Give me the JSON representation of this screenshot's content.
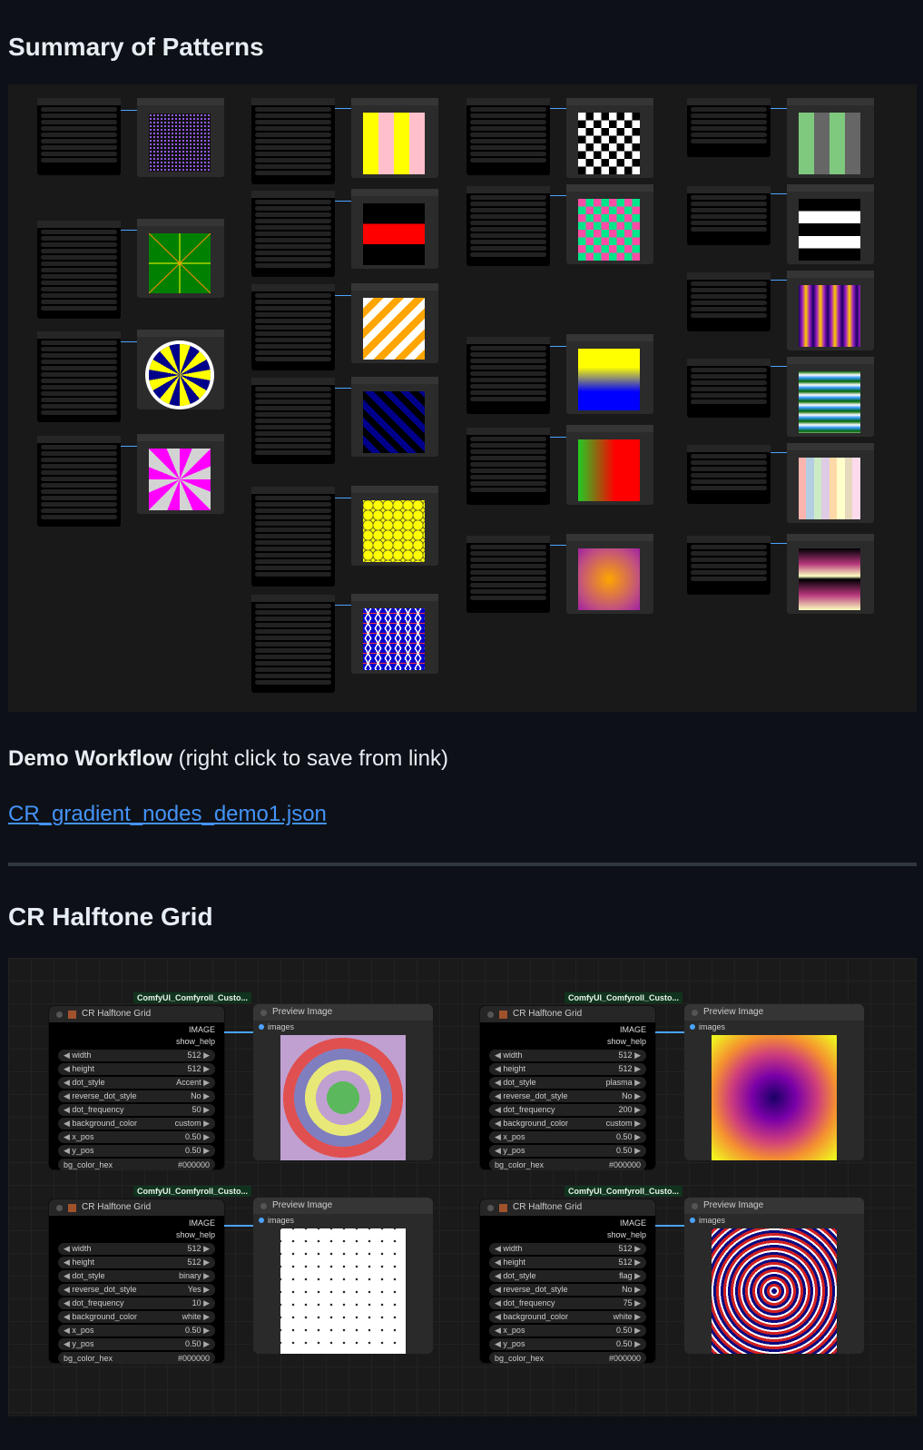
{
  "section1": {
    "title": "Summary of Patterns"
  },
  "demo": {
    "label_bold": "Demo Workflow",
    "label_rest": " (right click to save from link)",
    "link_text": "CR_gradient_nodes_demo1.json"
  },
  "section2": {
    "title": "CR Halftone Grid"
  },
  "halftone_nodes": [
    {
      "badge": "ComfyUI_Comfyroll_Custo...",
      "title": "CR Halftone Grid",
      "output": "IMAGE",
      "show_help": "show_help",
      "widgets": [
        {
          "label": "width",
          "value": "512"
        },
        {
          "label": "height",
          "value": "512"
        },
        {
          "label": "dot_style",
          "value": "Accent"
        },
        {
          "label": "reverse_dot_style",
          "value": "No"
        },
        {
          "label": "dot_frequency",
          "value": "50"
        },
        {
          "label": "background_color",
          "value": "custom"
        },
        {
          "label": "x_pos",
          "value": "0.50"
        },
        {
          "label": "y_pos",
          "value": "0.50"
        },
        {
          "label": "bg_color_hex",
          "value": "#000000"
        }
      ],
      "preview_title": "Preview Image",
      "preview_input": "images"
    },
    {
      "badge": "ComfyUI_Comfyroll_Custo...",
      "title": "CR Halftone Grid",
      "output": "IMAGE",
      "show_help": "show_help",
      "widgets": [
        {
          "label": "width",
          "value": "512"
        },
        {
          "label": "height",
          "value": "512"
        },
        {
          "label": "dot_style",
          "value": "plasma"
        },
        {
          "label": "reverse_dot_style",
          "value": "No"
        },
        {
          "label": "dot_frequency",
          "value": "200"
        },
        {
          "label": "background_color",
          "value": "custom"
        },
        {
          "label": "x_pos",
          "value": "0.50"
        },
        {
          "label": "y_pos",
          "value": "0.50"
        },
        {
          "label": "bg_color_hex",
          "value": "#000000"
        }
      ],
      "preview_title": "Preview Image",
      "preview_input": "images"
    },
    {
      "badge": "ComfyUI_Comfyroll_Custo...",
      "title": "CR Halftone Grid",
      "output": "IMAGE",
      "show_help": "show_help",
      "widgets": [
        {
          "label": "width",
          "value": "512"
        },
        {
          "label": "height",
          "value": "512"
        },
        {
          "label": "dot_style",
          "value": "binary"
        },
        {
          "label": "reverse_dot_style",
          "value": "Yes"
        },
        {
          "label": "dot_frequency",
          "value": "10"
        },
        {
          "label": "background_color",
          "value": "white"
        },
        {
          "label": "x_pos",
          "value": "0.50"
        },
        {
          "label": "y_pos",
          "value": "0.50"
        },
        {
          "label": "bg_color_hex",
          "value": "#000000"
        }
      ],
      "preview_title": "Preview Image",
      "preview_input": "images"
    },
    {
      "badge": "ComfyUI_Comfyroll_Custo...",
      "title": "CR Halftone Grid",
      "output": "IMAGE",
      "show_help": "show_help",
      "widgets": [
        {
          "label": "width",
          "value": "512"
        },
        {
          "label": "height",
          "value": "512"
        },
        {
          "label": "dot_style",
          "value": "flag"
        },
        {
          "label": "reverse_dot_style",
          "value": "No"
        },
        {
          "label": "dot_frequency",
          "value": "75"
        },
        {
          "label": "background_color",
          "value": "white"
        },
        {
          "label": "x_pos",
          "value": "0.50"
        },
        {
          "label": "y_pos",
          "value": "0.50"
        },
        {
          "label": "bg_color_hex",
          "value": "#000000"
        }
      ],
      "preview_title": "Preview Image",
      "preview_input": "images"
    }
  ],
  "colors": {
    "page_bg": "#0d1117",
    "link": "#4493f8",
    "wire": "#4aa3ff",
    "node_bg": "#000000"
  }
}
